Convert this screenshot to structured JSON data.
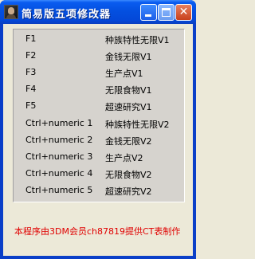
{
  "window": {
    "title": "简易版五项修改器"
  },
  "hotkeys": [
    {
      "key": "F1",
      "function": "种族特性无限V1"
    },
    {
      "key": "F2",
      "function": "金钱无限V1"
    },
    {
      "key": "F3",
      "function": "生产点V1"
    },
    {
      "key": "F4",
      "function": "无限食物V1"
    },
    {
      "key": "F5",
      "function": "超速研究V1"
    },
    {
      "key": "Ctrl+numeric 1",
      "function": "种族特性无限V2"
    },
    {
      "key": "Ctrl+numeric 2",
      "function": "金钱无限V2"
    },
    {
      "key": "Ctrl+numeric 3",
      "function": "生产点V2"
    },
    {
      "key": "Ctrl+numeric 4",
      "function": "无限食物V2"
    },
    {
      "key": "Ctrl+numeric 5",
      "function": "超速研究V2"
    }
  ],
  "credit": "本程序由3DM会员ch87819提供CT表制作",
  "icons": {
    "app": "character-portrait-icon",
    "minimize": "minimize-icon",
    "maximize": "maximize-icon",
    "close": "close-icon"
  },
  "colors": {
    "titlebar": "#0450e0",
    "credit_text": "#e00000",
    "client_bg": "#ece9d8"
  }
}
